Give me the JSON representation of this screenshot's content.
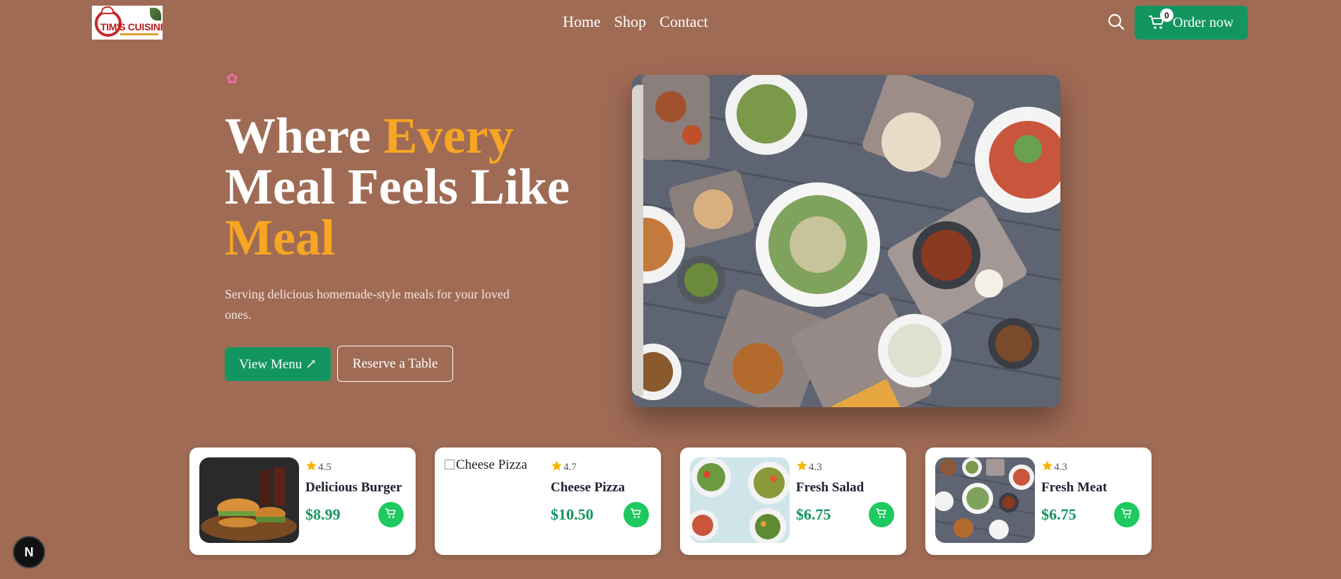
{
  "brand": {
    "logo_text": "TIM'S CUISINE"
  },
  "nav": {
    "items": [
      "Home",
      "Shop",
      "Contact"
    ]
  },
  "header": {
    "order_label": "Order now",
    "cart_count": "0"
  },
  "hero": {
    "title_part1": "Where ",
    "title_accent1": "Every",
    "title_part2": " Meal Feels Like ",
    "title_accent2": "Meal",
    "subtitle": "Serving delicious homemade-style meals for your loved ones.",
    "primary_button": "View Menu ↗",
    "secondary_button": "Reserve a Table"
  },
  "products": [
    {
      "name": "Delicious Burger",
      "rating": "4.5",
      "price": "$8.99",
      "image": "burger-photo"
    },
    {
      "name": "Cheese Pizza",
      "rating": "4.7",
      "price": "$10.50",
      "image_alt": "Cheese Pizza"
    },
    {
      "name": "Fresh Salad",
      "rating": "4.3",
      "price": "$6.75",
      "image": "salad-photo"
    },
    {
      "name": "Fresh Meat",
      "rating": "4.3",
      "price": "$6.75",
      "image": "meat-photo"
    }
  ],
  "dev_badge": {
    "label": "N"
  },
  "colors": {
    "background": "#a06b55",
    "accent": "#f6a623",
    "primary": "#139560",
    "cart_button": "#1ec95f"
  }
}
